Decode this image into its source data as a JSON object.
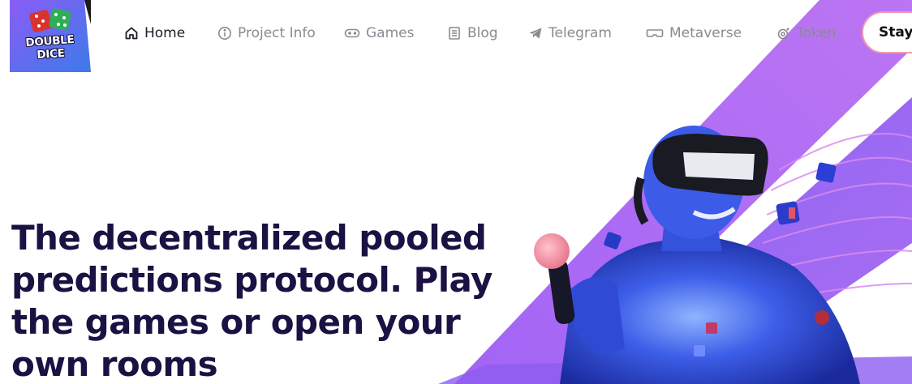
{
  "brand": {
    "logo_text": "DOUBLE DICE"
  },
  "nav": {
    "items": [
      {
        "label": "Home",
        "icon": "home-icon",
        "active": true
      },
      {
        "label": "Project Info",
        "icon": "info-icon",
        "active": false
      },
      {
        "label": "Games",
        "icon": "gamepad-icon",
        "active": false
      },
      {
        "label": "Blog",
        "icon": "document-icon",
        "active": false
      },
      {
        "label": "Telegram",
        "icon": "telegram-icon",
        "active": false
      },
      {
        "label": "Metaverse",
        "icon": "vr-headset-icon",
        "active": false
      },
      {
        "label": "Token",
        "icon": "token-icon",
        "active": false
      }
    ],
    "cta_label": "Stay"
  },
  "hero": {
    "headline": "The decentralized pooled predictions protocol. Play the games or open your own rooms"
  },
  "colors": {
    "text_dark": "#1b1142",
    "nav_gray": "#8a8a93",
    "accent_purple": "#a552f0",
    "accent_pink": "#ef9ab2",
    "hero_blue": "#3145d6"
  }
}
